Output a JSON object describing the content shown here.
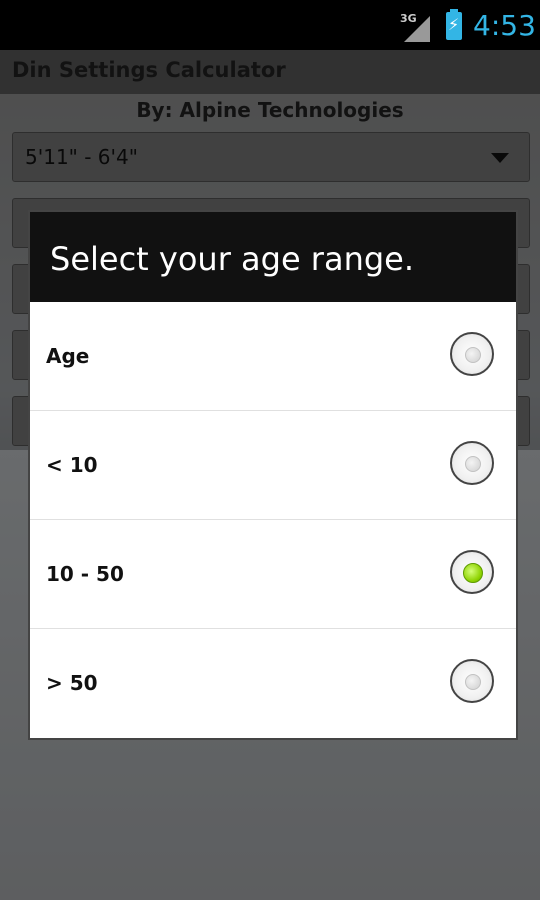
{
  "status_bar": {
    "network": "3G",
    "time": "4:53",
    "icons": [
      "signal-icon",
      "battery-charging-icon"
    ],
    "accent_color": "#33b5e5"
  },
  "app": {
    "title": "Din Settings Calculator",
    "subtitle": "By: Alpine Technologies",
    "height_select": {
      "value": "5'11\" - 6'4\""
    }
  },
  "dialog": {
    "title": "Select your age range.",
    "options": [
      {
        "label": "Age",
        "checked": false
      },
      {
        "label": "< 10",
        "checked": false
      },
      {
        "label": "10 - 50",
        "checked": true
      },
      {
        "label": "> 50",
        "checked": false
      }
    ]
  }
}
